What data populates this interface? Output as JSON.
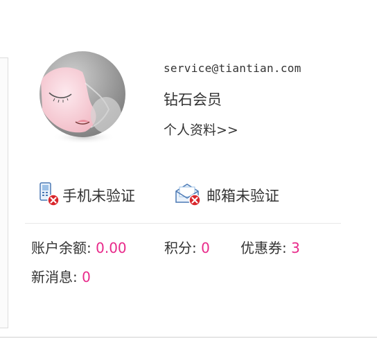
{
  "user": {
    "email": "service@tiantian.com",
    "level": "钻石会员",
    "profile_link": "个人资料>>"
  },
  "verification": {
    "phone_label": "手机未验证",
    "email_label": "邮箱未验证"
  },
  "stats": {
    "balance_label": "账户余额:",
    "balance_value": "0.00",
    "points_label": "积分:",
    "points_value": "0",
    "coupons_label": "优惠券:",
    "coupons_value": "3",
    "messages_label": "新消息:",
    "messages_value": "0"
  },
  "colors": {
    "value_accent": "#e8298a",
    "badge_red": "#d9262c",
    "avatar_grey": "#8a8a8a",
    "avatar_pink": "#f6c9d1"
  },
  "icons": {
    "avatar": "default-female-avatar",
    "phone": "phone-icon",
    "mail": "mail-icon",
    "badge": "x-badge-icon"
  }
}
